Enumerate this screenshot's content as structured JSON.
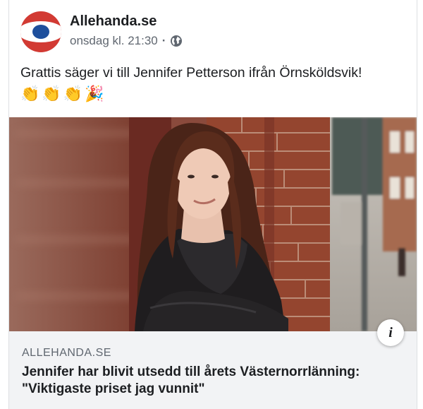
{
  "post": {
    "page_name": "Allehanda.se",
    "timestamp": "onsdag kl. 21:30",
    "separator": "·",
    "privacy_icon": "globe-icon",
    "text": "Grattis säger vi till Jennifer Petterson ifrån Örnsköldsvik!",
    "emojis": [
      "👏",
      "👏",
      "👏",
      "🎉"
    ]
  },
  "link": {
    "domain": "ALLEHANDA.SE",
    "headline": "Jennifer har blivit utsedd till årets Västernorrlänning: \"Viktigaste priset jag vunnit\"",
    "info_icon": "i"
  },
  "colors": {
    "logo_red": "#d23a33",
    "logo_blue": "#1e4f9c",
    "link_box_bg": "#f2f3f5",
    "secondary_text": "#606770"
  }
}
